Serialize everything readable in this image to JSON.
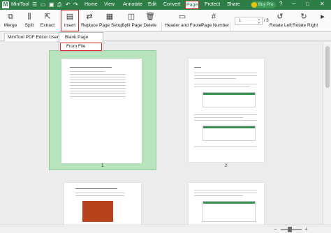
{
  "title_bar": {
    "app_name": "MiniTool",
    "menus": [
      "Home",
      "View",
      "Annotate",
      "Edit",
      "Convert",
      "Page",
      "Protect",
      "Share"
    ],
    "active_menu": "Page",
    "pro_label": "Buy Pro",
    "accent_color": "#2d7d46"
  },
  "ribbon": {
    "merge": "Merge",
    "split": "Split",
    "extract": "Extract",
    "insert": "Insert",
    "replace": "Replace",
    "page_setup": "Page Setup",
    "split_page": "Split Page",
    "delete": "Delete",
    "header_footer": "Header and Footer",
    "page_number": "Page Number",
    "current_page": "1",
    "page_total": "/ 8",
    "rotate_left": "Rotate Left",
    "rotate_right": "Rotate Right"
  },
  "document_tab": "MiniTool PDF Editor User Guide",
  "insert_menu": {
    "blank_page": "Blank Page",
    "from_file": "From File"
  },
  "pages": [
    {
      "number": "1",
      "selected": true
    },
    {
      "number": "2",
      "selected": false
    }
  ],
  "zoom": {
    "minus": "−",
    "plus": "+"
  }
}
